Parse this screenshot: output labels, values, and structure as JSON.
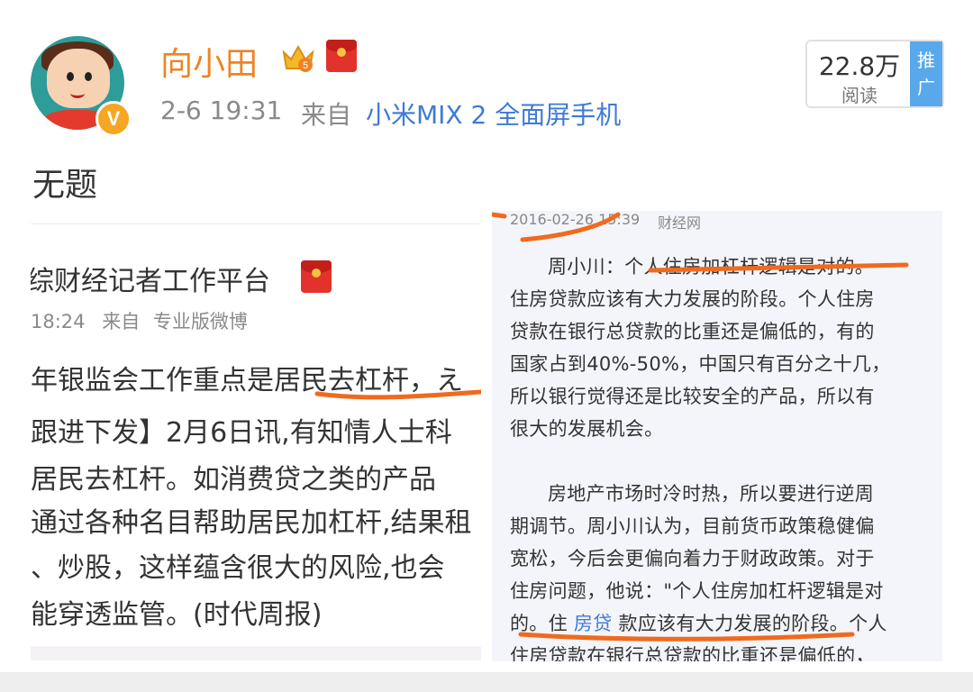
{
  "post": {
    "username": "向小田",
    "crown_icon": "crown-level-icon",
    "crown_level": "5",
    "redpacket_icon": "red-packet-icon",
    "verified_badge": "V",
    "time": "2-6 19:31",
    "from_label": "来自",
    "device": "小米MIX 2 全面屏手机",
    "read_count": "22.8万",
    "read_label": "阅读",
    "promo_label_1": "推",
    "promo_label_2": "广",
    "title": "无题"
  },
  "left_screenshot": {
    "account": "综财经记者工作平台",
    "time": "18:24",
    "from_label": "来自",
    "client": "专业版微博",
    "lines": [
      "年银监会工作重点是居民去杠杆，え",
      "跟进下发】2月6日讯,有知情人士科",
      "居民去杠杆。如消费贷之类的产品",
      "通过各种名目帮助居民加杠杆,结果租",
      "、炒股，这样蕴含很大的风险,也会",
      "能穿透监管。(时代周报)"
    ]
  },
  "right_screenshot": {
    "date": "2016-02-26 15:39",
    "source": "财经网",
    "para1": [
      "周小川：个人住房加杠杆逻辑是对的。",
      "住房贷款应该有大力发展的阶段。个人住房",
      "贷款在银行总贷款的比重还是偏低的，有的",
      "国家占到40%-50%，中国只有百分之十几，",
      "所以银行觉得还是比较安全的产品，所以有",
      "很大的发展机会。"
    ],
    "para2": [
      "房地产市场时冷时热，所以要进行逆周",
      "期调节。周小川认为，目前货币政策稳健偏",
      "宽松，今后会更偏向着力于财政政策。对于",
      "住房问题，他说：\"个人住房加杠杆逻辑是对"
    ],
    "line_last_prefix": "的。住",
    "link_text": "房贷",
    "line_last_suffix": "款应该有大力发展的阶段。个人",
    "line_final": "住房贷款在银行总贷款的比重还是偏低的，"
  },
  "colors": {
    "username": "#f08223",
    "link": "#3e7ad7",
    "annotation": "#f06a1e",
    "promo": "#5aa8ec"
  }
}
